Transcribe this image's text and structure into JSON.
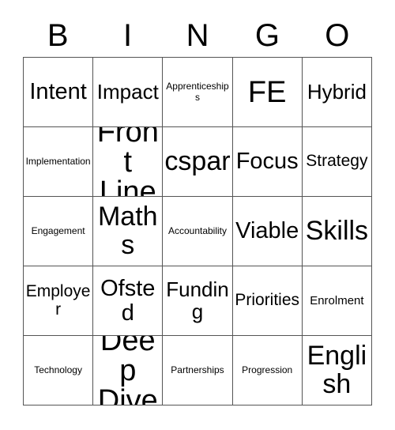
{
  "card": {
    "title": "BINGO",
    "header_letters": [
      "B",
      "I",
      "N",
      "G",
      "O"
    ],
    "colors": {
      "background": "#ffffff",
      "text": "#000000",
      "grid_line": "#555555"
    },
    "grid": {
      "rows": 5,
      "columns": 5,
      "cells": [
        {
          "label": "Intent",
          "size": "xl"
        },
        {
          "label": "Impact",
          "size": "lg"
        },
        {
          "label": "Apprenticeships",
          "size": "xs"
        },
        {
          "label": "FE",
          "size": "huge"
        },
        {
          "label": "Hybrid",
          "size": "lg"
        },
        {
          "label": "Implementation",
          "size": "xs"
        },
        {
          "label": "Front Line",
          "size": "huge"
        },
        {
          "label": "cspar",
          "size": "xxl"
        },
        {
          "label": "Focus",
          "size": "xl"
        },
        {
          "label": "Strategy",
          "size": "md"
        },
        {
          "label": "Engagement",
          "size": "xs"
        },
        {
          "label": "Maths",
          "size": "xxl"
        },
        {
          "label": "Accountability",
          "size": "xs"
        },
        {
          "label": "Viable",
          "size": "xl"
        },
        {
          "label": "Skills",
          "size": "xxl"
        },
        {
          "label": "Employer",
          "size": "md"
        },
        {
          "label": "Ofsted",
          "size": "xl"
        },
        {
          "label": "Funding",
          "size": "lg"
        },
        {
          "label": "Priorities",
          "size": "md"
        },
        {
          "label": "Enrolment",
          "size": "sm"
        },
        {
          "label": "Technology",
          "size": "xs"
        },
        {
          "label": "Deep Dive",
          "size": "huge"
        },
        {
          "label": "Partnerships",
          "size": "xs"
        },
        {
          "label": "Progression",
          "size": "xs"
        },
        {
          "label": "English",
          "size": "xxl"
        }
      ]
    }
  }
}
